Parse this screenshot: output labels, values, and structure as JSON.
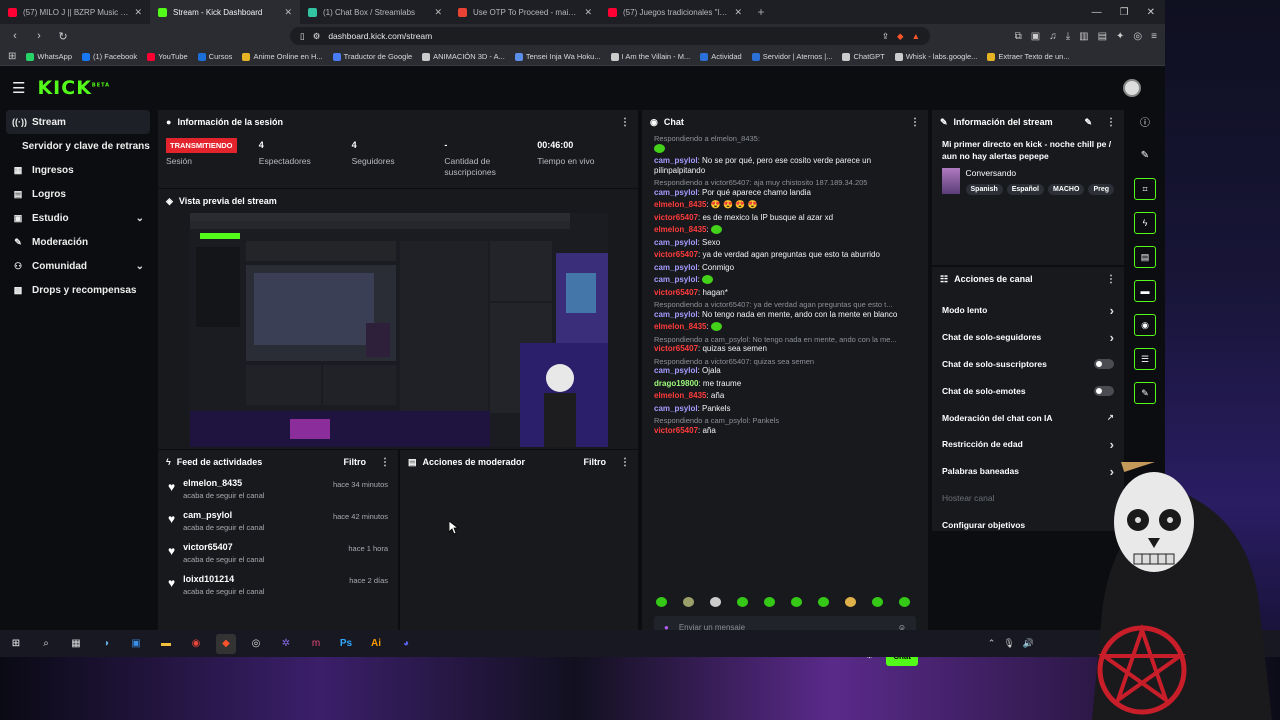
{
  "browser": {
    "tabs": [
      {
        "label": "(57) MILO J || BZRP Music Sessio",
        "color": "#ff0033",
        "active": false
      },
      {
        "label": "Stream - Kick Dashboard",
        "color": "#53fc18",
        "active": true
      },
      {
        "label": "(1) Chat Box / Streamlabs",
        "color": "#31c3a2",
        "active": false
      },
      {
        "label": "Use OTP To Proceed - maicolvg.2002",
        "color": "#ea4335",
        "active": false
      },
      {
        "label": "(57) Juegos tradicionales \"los yases\"",
        "color": "#ff0033",
        "active": false
      }
    ],
    "url": "dashboard.kick.com/stream",
    "bookmarks": [
      {
        "label": "WhatsApp",
        "color": "#25d366"
      },
      {
        "label": "(1) Facebook",
        "color": "#1877f2"
      },
      {
        "label": "YouTube",
        "color": "#ff0033"
      },
      {
        "label": "Cursos",
        "color": "#1b6fd9"
      },
      {
        "label": "Anime Online en H...",
        "color": "#e6b422"
      },
      {
        "label": "Traductor de Google",
        "color": "#4a7cf7"
      },
      {
        "label": "ANIMACIÓN 3D - A...",
        "color": "#cccccc"
      },
      {
        "label": "Tensei Inja Wa Hoku...",
        "color": "#5a8ee8"
      },
      {
        "label": "I Am the Villain - M...",
        "color": "#cccccc"
      },
      {
        "label": "Actividad",
        "color": "#2b6fd9"
      },
      {
        "label": "Servidor | Aternos |...",
        "color": "#2b6fd9"
      },
      {
        "label": "ChatGPT",
        "color": "#cccccc"
      },
      {
        "label": "Whisk - labs.google...",
        "color": "#cccccc"
      },
      {
        "label": "Extraer Texto de un...",
        "color": "#e6b422"
      }
    ]
  },
  "app": {
    "logo": "KICK",
    "logo_sup": "BETA"
  },
  "sidebar": {
    "items": [
      {
        "label": "Stream",
        "icon": "broadcast-icon",
        "glyph": "((·))",
        "active": true,
        "chevron": false
      },
      {
        "label": "Servidor y clave de retransmisión",
        "icon": "",
        "glyph": "",
        "sub": true,
        "chevron": false
      },
      {
        "label": "Ingresos",
        "icon": "revenue-icon",
        "glyph": "▦",
        "chevron": false
      },
      {
        "label": "Logros",
        "icon": "achievements-icon",
        "glyph": "▤",
        "chevron": false
      },
      {
        "label": "Estudio",
        "icon": "studio-icon",
        "glyph": "▣",
        "chevron": true
      },
      {
        "label": "Moderación",
        "icon": "wrench-icon",
        "glyph": "✎",
        "chevron": false
      },
      {
        "label": "Comunidad",
        "icon": "community-icon",
        "glyph": "⚇",
        "chevron": true
      },
      {
        "label": "Drops y recompensas",
        "icon": "drops-icon",
        "glyph": "▩",
        "chevron": false
      }
    ]
  },
  "session": {
    "title": "Información de la sesión",
    "stats": [
      {
        "value": "TRANSMITIENDO",
        "label": "Sesión",
        "badge": true
      },
      {
        "value": "4",
        "label": "Espectadores"
      },
      {
        "value": "4",
        "label": "Seguidores"
      },
      {
        "value": "-",
        "label": "Cantidad de suscripciones"
      },
      {
        "value": "00:46:00",
        "label": "Tiempo en vivo"
      }
    ]
  },
  "preview": {
    "title": "Vista previa del stream"
  },
  "feed": {
    "title": "Feed de actividades",
    "filter": "Filtro",
    "items": [
      {
        "name": "elmelon_8435",
        "sub": "acaba de seguir el canal",
        "time": "hace 34 minutos"
      },
      {
        "name": "cam_psylol",
        "sub": "acaba de seguir el canal",
        "time": "hace 42 minutos"
      },
      {
        "name": "victor65407",
        "sub": "acaba de seguir el canal",
        "time": "hace 1 hora"
      },
      {
        "name": "loixd101214",
        "sub": "acaba de seguir el canal",
        "time": "hace 2 días"
      }
    ]
  },
  "modactions": {
    "title": "Acciones de moderador",
    "filter": "Filtro"
  },
  "chat": {
    "title": "Chat",
    "input_placeholder": "Enviar un mensaje",
    "send": "Chat",
    "messages": [
      {
        "reply": "Respondiendo a elmelon_8435:",
        "user": "",
        "text": "",
        "ucls": "green",
        "emote": true
      },
      {
        "user": "cam_psylol",
        "text": ": No se por qué, pero ese cosito verde parece un pilinpalpitando",
        "ucls": "green"
      },
      {
        "reply": "Respondiendo a victor65407: aja muy chistosito 187.189.34.205",
        "user": "cam_psylol",
        "text": ": Por qué aparece chamo landia",
        "ucls": "green"
      },
      {
        "user": "elmelon_8435",
        "text": ": 😍 😍 😍 😍",
        "ucls": "red"
      },
      {
        "user": "victor65407",
        "text": ": es de mexico la IP busque al azar xd",
        "ucls": "red"
      },
      {
        "user": "elmelon_8435",
        "text": ":",
        "ucls": "red",
        "emote": true
      },
      {
        "user": "cam_psylol",
        "text": ": Sexo",
        "ucls": "green"
      },
      {
        "user": "victor65407",
        "text": ": ya de verdad agan preguntas que esto ta aburrido",
        "ucls": "red"
      },
      {
        "user": "cam_psylol",
        "text": ": Conmigo",
        "ucls": "green"
      },
      {
        "user": "cam_psylol",
        "text": ":",
        "ucls": "green",
        "emote": true
      },
      {
        "user": "victor65407",
        "text": ": hagan*",
        "ucls": "red"
      },
      {
        "reply": "Respondiendo a victor65407: ya de verdad agan preguntas que esto t...",
        "user": "cam_psylol",
        "text": ": No tengo nada en mente, ando con la mente en blanco",
        "ucls": "green"
      },
      {
        "user": "elmelon_8435",
        "text": ":",
        "ucls": "red",
        "emote": true
      },
      {
        "reply": "Respondiendo a cam_psylol: No tengo nada en mente, ando con la me...",
        "user": "victor65407",
        "text": ": quizas sea semen",
        "ucls": "red"
      },
      {
        "reply": "Respondiendo a victor65407: quizas sea semen",
        "user": "cam_psylol",
        "text": ": Ojala",
        "ucls": "green"
      },
      {
        "user": "drago19800",
        "text": ": me traume",
        "ucls": "lime"
      },
      {
        "user": "elmelon_8435",
        "text": ": aña",
        "ucls": "red"
      },
      {
        "user": "cam_psylol",
        "text": ": Pankels",
        "ucls": "green"
      },
      {
        "reply": "Respondiendo a cam_psylol: Pankels",
        "user": "victor65407",
        "text": ": aña",
        "ucls": "red"
      }
    ]
  },
  "stream_info": {
    "title": "Información del stream",
    "stream_title": "Mi primer directo en kick - noche chill pe / aun no hay alertas pepepe",
    "category": "Conversando",
    "tags": [
      "Spanish",
      "Español",
      "MACHO",
      "Preg"
    ]
  },
  "channel_actions": {
    "title": "Acciones de canal",
    "items": [
      {
        "label": "Modo lento",
        "control": "chevron"
      },
      {
        "label": "Chat de solo-seguidores",
        "control": "chevron"
      },
      {
        "label": "Chat de solo-suscriptores",
        "control": "toggle"
      },
      {
        "label": "Chat de solo-emotes",
        "control": "toggle"
      },
      {
        "label": "Moderación del chat con IA",
        "control": "chart"
      },
      {
        "label": "Restricción de edad",
        "control": "chevron"
      },
      {
        "label": "Palabras baneadas",
        "control": "chevron"
      },
      {
        "label": "Hostear canal",
        "control": "none",
        "dim": true
      },
      {
        "label": "Configurar objetivos",
        "control": "none"
      }
    ]
  }
}
